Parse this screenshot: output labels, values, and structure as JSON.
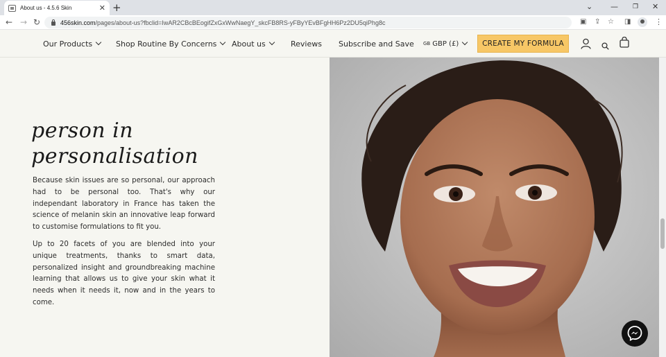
{
  "browser": {
    "tab_title": "About us - 4.5.6 Skin",
    "url_host": "456skin.com",
    "url_path": "/pages/about-us?fbclid=IwAR2CBcBEogifZxGxWwNaegY_skcFB8RS-yFByYEvBFgHH6Pz2DU5qiPhg8c"
  },
  "nav": {
    "our_products": "Our Products",
    "shop_routine": "Shop Routine By Concerns",
    "about_us": "About us",
    "reviews": "Reviews",
    "subscribe": "Subscribe and Save",
    "currency_flag": "GB",
    "currency": "GBP (£)",
    "cta": "CREATE MY FORMULA"
  },
  "content": {
    "heading_line1": "person in",
    "heading_line2": "personalisation",
    "paragraph1": "Because skin issues are so personal, our approach had to be personal too. That's why our independant laboratory in France has taken the science of melanin skin an innovative leap forward to customise formulations to fit you.",
    "paragraph2": "Up to 20 facets of you are blended into your unique treatments, thanks to smart data, personalized insight and groundbreaking machine learning that allows us to give your skin what it needs when it needs it, now and in the years to come."
  },
  "icons": {
    "account": "user-icon",
    "search": "search-icon",
    "cart": "bag-icon",
    "chat": "messenger-icon"
  },
  "colors": {
    "cta_bg": "#f7c766",
    "page_bg": "#f6f6f1"
  }
}
